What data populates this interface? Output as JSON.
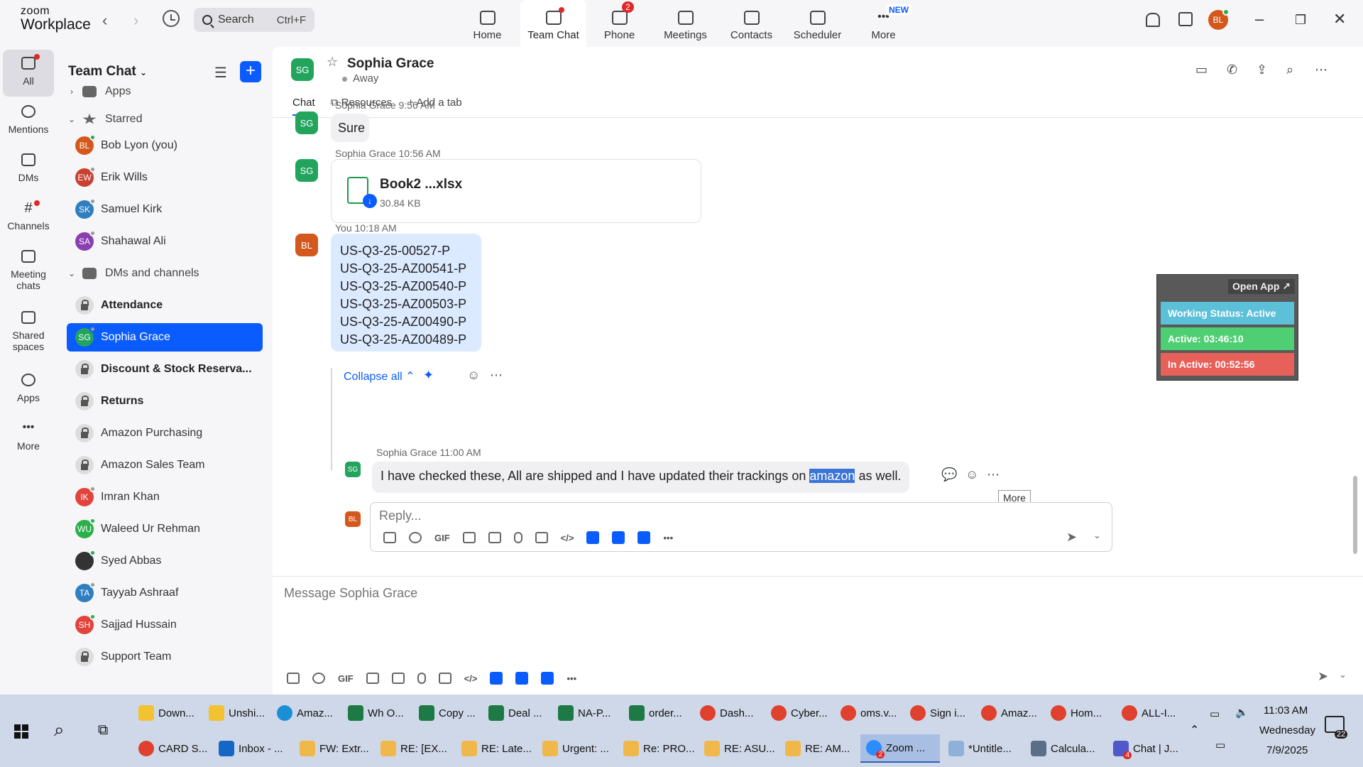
{
  "app": {
    "logo_line1": "zoom",
    "logo_line2": "Workplace"
  },
  "topbar": {
    "search_label": "Search",
    "search_shortcut": "Ctrl+F",
    "tabs": [
      {
        "label": "Home",
        "icon": "home-icon"
      },
      {
        "label": "Team Chat",
        "icon": "chat-icon",
        "active": true
      },
      {
        "label": "Phone",
        "icon": "phone-icon",
        "badge": "2"
      },
      {
        "label": "Meetings",
        "icon": "video-icon"
      },
      {
        "label": "Contacts",
        "icon": "contacts-icon"
      },
      {
        "label": "Scheduler",
        "icon": "calendar-icon"
      },
      {
        "label": "More",
        "icon": "more-icon",
        "badge": "NEW"
      }
    ],
    "user_initials": "BL"
  },
  "rail": [
    {
      "label": "All",
      "icon": "chat-icon",
      "active": true
    },
    {
      "label": "Mentions",
      "icon": "at-icon"
    },
    {
      "label": "DMs",
      "icon": "people-icon"
    },
    {
      "label": "Channels",
      "icon": "hash-icon"
    },
    {
      "label": "Meeting chats",
      "icon": "calendar-icon"
    },
    {
      "label": "Shared spaces",
      "icon": "share-icon"
    },
    {
      "label": "Apps",
      "icon": "apps-icon"
    },
    {
      "label": "More",
      "icon": "more-icon"
    }
  ],
  "sidebar": {
    "title": "Team Chat",
    "apps_label": "Apps",
    "starred_label": "Starred",
    "dms_label": "DMs and channels",
    "starred": [
      {
        "name": "Bob Lyon (you)",
        "initials": "BL",
        "color": "#d4581c",
        "presence": "#22b14c"
      },
      {
        "name": "Erik Wills",
        "initials": "EW",
        "color": "#c8402f",
        "presence": "#999999"
      },
      {
        "name": "Samuel Kirk",
        "initials": "SK",
        "color": "#2f7fc0",
        "presence": "#999999"
      },
      {
        "name": "Shahawal Ali",
        "initials": "SA",
        "color": "#8a3fb0",
        "presence": "#999999"
      }
    ],
    "items": [
      {
        "name": "Attendance",
        "type": "channel",
        "bold": true
      },
      {
        "name": "Sophia Grace",
        "initials": "SG",
        "color": "#22a45d",
        "presence": "#999999",
        "active": true
      },
      {
        "name": "Discount & Stock Reserva...",
        "type": "channel",
        "bold": true
      },
      {
        "name": "Returns",
        "type": "channel",
        "bold": true
      },
      {
        "name": "Amazon Purchasing",
        "type": "channel"
      },
      {
        "name": "Amazon Sales Team",
        "type": "channel"
      },
      {
        "name": "Imran Khan",
        "initials": "IK",
        "color": "#e2443c",
        "presence": "#999999"
      },
      {
        "name": "Waleed Ur Rehman",
        "initials": "WU",
        "color": "#2bb04a",
        "presence": "#22b14c"
      },
      {
        "name": "Syed Abbas",
        "initials": "",
        "color": "#333333",
        "presence": "#22b14c"
      },
      {
        "name": "Tayyab Ashraaf",
        "initials": "TA",
        "color": "#2f7fc0",
        "presence": "#999999"
      },
      {
        "name": "Sajjad Hussain",
        "initials": "SH",
        "color": "#e2443c",
        "presence": "#22b14c"
      },
      {
        "name": "Support Team",
        "type": "channel"
      }
    ]
  },
  "chat": {
    "contact_name": "Sophia Grace",
    "contact_initials": "SG",
    "status": "Away",
    "tabs": [
      "Chat",
      "Resources",
      "Add a tab"
    ],
    "messages": [
      {
        "author": "Sophia Grace",
        "time": "9:56 AM",
        "text": "Sure"
      },
      {
        "author": "Sophia Grace",
        "time": "10:56 AM",
        "file_name": "Book2 ...xlsx",
        "file_size": "30.84 KB"
      },
      {
        "author": "You",
        "time": "10:18 AM",
        "lines": [
          "US-Q3-25-00527-P",
          "US-Q3-25-AZ00541-P",
          "US-Q3-25-AZ00540-P",
          "US-Q3-25-AZ00503-P",
          "US-Q3-25-AZ00490-P",
          "US-Q3-25-AZ00489-P"
        ]
      }
    ],
    "collapse_label": "Collapse all",
    "reply": {
      "author": "Sophia Grace",
      "time": "11:00 AM",
      "text_before": "I have checked these, All are shipped and I have updated their trackings on ",
      "highlight": "amazon",
      "text_after": " as well."
    },
    "tooltip": "More",
    "reply_placeholder": "Reply...",
    "compose_placeholder": "Message Sophia Grace",
    "toolbar_gif": "GIF"
  },
  "widget": {
    "open_app": "Open App ↗",
    "working_status": "Working Status: Active",
    "active": "Active: 03:46:10",
    "inactive": "In Active: 00:52:56",
    "colors": {
      "status": "#5bc0d8",
      "active": "#4fcf73",
      "inactive": "#e8605a"
    }
  },
  "taskbar": {
    "row1": [
      "Down...",
      "Unshi...",
      "Amaz...",
      "Wh O...",
      "Copy ...",
      "Deal ...",
      "NA-P...",
      "order...",
      "Dash...",
      "Cyber...",
      "oms.v...",
      "Sign i...",
      "Amaz...",
      "Hom...",
      "ALL-I..."
    ],
    "row2": [
      "CARD S...",
      "Inbox - ...",
      "FW: Extr...",
      "RE: [EX...",
      "RE: Late...",
      "Urgent: ...",
      "Re: PRO...",
      "RE: ASU...",
      "RE: AM...",
      "Zoom ...",
      "*Untitle...",
      "Calcula...",
      "Chat | J..."
    ],
    "zoom_badge": "2",
    "teams_badge": "4",
    "time": "11:03 AM",
    "day": "Wednesday",
    "date": "7/9/2025",
    "notif_count": "22"
  }
}
